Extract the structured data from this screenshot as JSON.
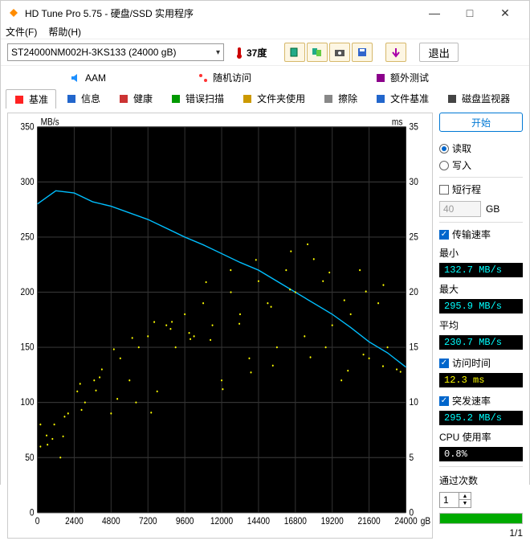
{
  "window": {
    "title": "HD Tune Pro 5.75 - 硬盘/SSD 实用程序",
    "min": "—",
    "max": "□",
    "close": "✕"
  },
  "menu": {
    "file": "文件(F)",
    "help": "帮助(H)"
  },
  "toolbar": {
    "drive": "ST24000NM002H-3KS133 (24000 gB)",
    "temp": "37度",
    "exit": "退出"
  },
  "tabs_row1": [
    {
      "label": "AAM",
      "name": "tab-aam",
      "iconColor": "#1e90ff"
    },
    {
      "label": "随机访问",
      "name": "tab-random",
      "iconColor": "#ff3333"
    },
    {
      "label": "额外测试",
      "name": "tab-extra",
      "iconColor": "#8b008b"
    }
  ],
  "tabs_row2": [
    {
      "label": "基准",
      "name": "tab-benchmark",
      "iconColor": "#ff2222",
      "active": true
    },
    {
      "label": "信息",
      "name": "tab-info",
      "iconColor": "#2266cc"
    },
    {
      "label": "健康",
      "name": "tab-health",
      "iconColor": "#cc3333"
    },
    {
      "label": "错误扫描",
      "name": "tab-error",
      "iconColor": "#009900"
    },
    {
      "label": "文件夹使用",
      "name": "tab-folder",
      "iconColor": "#cc9900"
    },
    {
      "label": "擦除",
      "name": "tab-erase",
      "iconColor": "#888888"
    },
    {
      "label": "文件基准",
      "name": "tab-filebench",
      "iconColor": "#2266cc"
    },
    {
      "label": "磁盘监视器",
      "name": "tab-monitor",
      "iconColor": "#444444"
    }
  ],
  "side": {
    "start": "开始",
    "read": "读取",
    "write": "写入",
    "short_stroke": "短行程",
    "short_val": "40",
    "short_unit": "GB",
    "transfer_rate": "传输速率",
    "min_label": "最小",
    "max_label": "最大",
    "avg_label": "平均",
    "access_label": "访问时间",
    "burst_label": "突发速率",
    "cpu_label": "CPU 使用率",
    "passes_label": "通过次数",
    "pass_value": "1",
    "pass_total": "1/1",
    "min_val": "132.7 MB/s",
    "max_val": "295.9 MB/s",
    "avg_val": "230.7 MB/s",
    "access_val": "12.3 ms",
    "burst_val": "295.2 MB/s",
    "cpu_val": "0.8%"
  },
  "chart_data": {
    "type": "line+scatter",
    "title": "",
    "left_axis": {
      "label": "MB/s",
      "min": 0,
      "max": 350,
      "ticks": [
        0,
        50,
        100,
        150,
        200,
        250,
        300,
        350
      ]
    },
    "right_axis": {
      "label": "ms",
      "min": 0,
      "max": 35,
      "ticks": [
        0,
        5,
        10,
        15,
        20,
        25,
        30,
        35
      ]
    },
    "x_axis": {
      "label": "gB",
      "min": 0,
      "max": 24000,
      "ticks": [
        0,
        2400,
        4800,
        7200,
        9600,
        12000,
        14400,
        16800,
        19200,
        21600,
        24000
      ]
    },
    "series": [
      {
        "name": "Transfer Rate",
        "type": "line",
        "color": "#00bfff",
        "x": [
          0,
          1200,
          2400,
          3600,
          4800,
          6000,
          7200,
          8400,
          9600,
          10800,
          12000,
          13200,
          14400,
          15600,
          16800,
          18000,
          19200,
          20400,
          21600,
          22800,
          24000
        ],
        "y": [
          280,
          292,
          290,
          282,
          278,
          272,
          266,
          258,
          250,
          243,
          235,
          227,
          220,
          210,
          200,
          190,
          180,
          168,
          155,
          145,
          132
        ]
      },
      {
        "name": "Access Time",
        "type": "scatter",
        "color": "#ffff00",
        "x": [
          200,
          600,
          1100,
          1500,
          2000,
          2600,
          3100,
          3700,
          4200,
          4800,
          5400,
          6000,
          6600,
          7200,
          7800,
          8400,
          9000,
          9600,
          10200,
          10800,
          11400,
          12000,
          12600,
          13200,
          13800,
          14400,
          15000,
          15600,
          16200,
          16800,
          17400,
          18000,
          18600,
          19200,
          19800,
          20400,
          21000,
          21600,
          22200,
          22800,
          23400
        ],
        "y": [
          6,
          7,
          8,
          5,
          9,
          11,
          10,
          12,
          13,
          9,
          14,
          12,
          15,
          16,
          11,
          17,
          15,
          18,
          16,
          19,
          17,
          12,
          20,
          18,
          14,
          21,
          19,
          15,
          22,
          20,
          16,
          23,
          21,
          17,
          12,
          18,
          22,
          14,
          19,
          15,
          13
        ]
      }
    ]
  }
}
